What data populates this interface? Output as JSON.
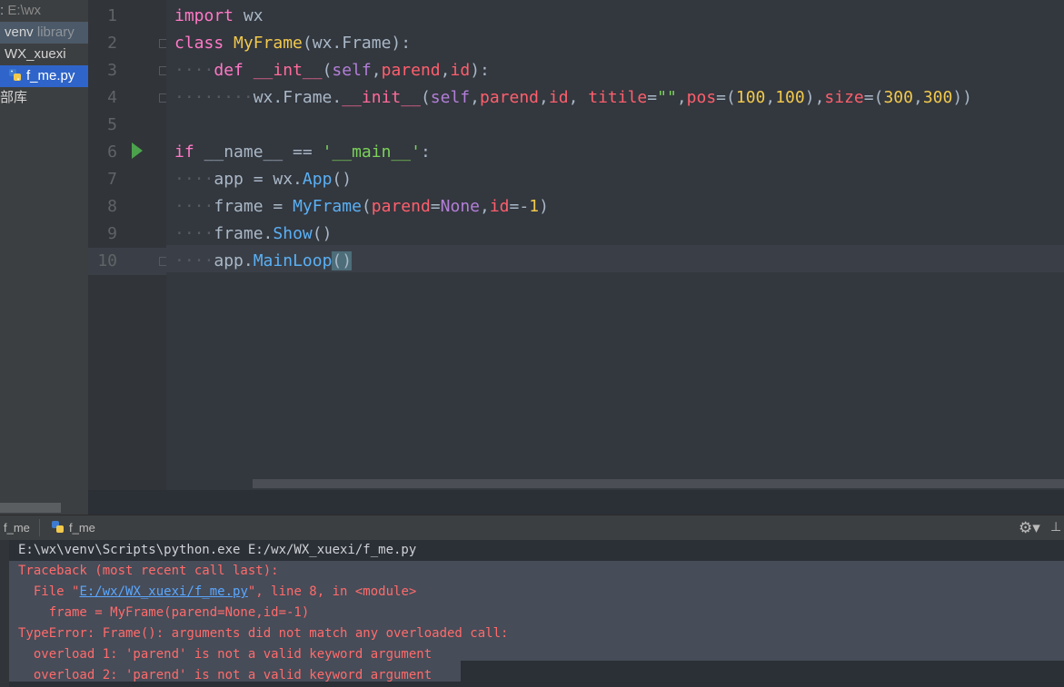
{
  "sidebar": {
    "root_prefix": ":",
    "root_path": "E:\\wx",
    "venv_label": "venv",
    "venv_suffix": "library",
    "project_folder": "WX_xuexi",
    "active_file": "f_me.py",
    "external_libs": "部库"
  },
  "editor": {
    "line_numbers": [
      "1",
      "2",
      "3",
      "4",
      "5",
      "6",
      "7",
      "8",
      "9",
      "10"
    ]
  },
  "run_panel": {
    "tab1_label": "f_me",
    "tab2_label": "f_me",
    "command": "E:\\wx\\venv\\Scripts\\python.exe E:/wx/WX_xuexi/f_me.py",
    "traceback_header": "Traceback (most recent call last):",
    "file_prefix": "  File \"",
    "file_link": "E:/wx/WX_xuexi/f_me.py",
    "file_suffix": "\", line 8, in <module>",
    "frame_line": "    frame = MyFrame(parend=None,id=-1)",
    "type_error": "TypeError: Frame(): arguments did not match any overloaded call:",
    "overload1": "  overload 1: 'parend' is not a valid keyword argument",
    "overload2": "  overload 2: 'parend' is not a valid keyword argument"
  },
  "colors": {
    "editor_bg": "#2b2f36",
    "keyword": "#ff79c6",
    "class_name": "#f1c94d",
    "error_text": "#ff6b6b",
    "selection_blue": "#2f65ca"
  }
}
